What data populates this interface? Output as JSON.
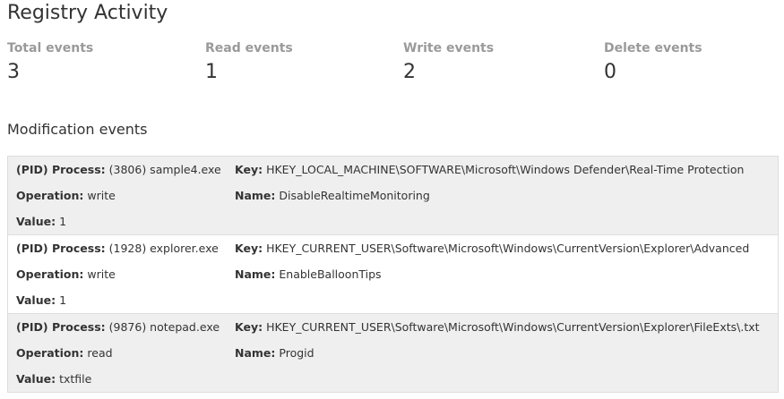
{
  "page": {
    "title": "Registry Activity"
  },
  "stats": [
    {
      "label": "Total events",
      "value": "3"
    },
    {
      "label": "Read events",
      "value": "1"
    },
    {
      "label": "Write events",
      "value": "2"
    },
    {
      "label": "Delete events",
      "value": "0"
    }
  ],
  "modifications": {
    "title": "Modification events",
    "labels": {
      "process": "(PID) Process:",
      "key": "Key:",
      "operation": "Operation:",
      "name": "Name:",
      "value": "Value:"
    },
    "events": [
      {
        "process": "(3806) sample4.exe",
        "key": "HKEY_LOCAL_MACHINE\\SOFTWARE\\Microsoft\\Windows Defender\\Real-Time Protection",
        "operation": "write",
        "name": "DisableRealtimeMonitoring",
        "value": "1"
      },
      {
        "process": "(1928) explorer.exe",
        "key": "HKEY_CURRENT_USER\\Software\\Microsoft\\Windows\\CurrentVersion\\Explorer\\Advanced",
        "operation": "write",
        "name": "EnableBalloonTips",
        "value": "1"
      },
      {
        "process": "(9876) notepad.exe",
        "key": "HKEY_CURRENT_USER\\Software\\Microsoft\\Windows\\CurrentVersion\\Explorer\\FileExts\\.txt",
        "operation": "read",
        "name": "Progid",
        "value": "txtfile"
      }
    ]
  }
}
